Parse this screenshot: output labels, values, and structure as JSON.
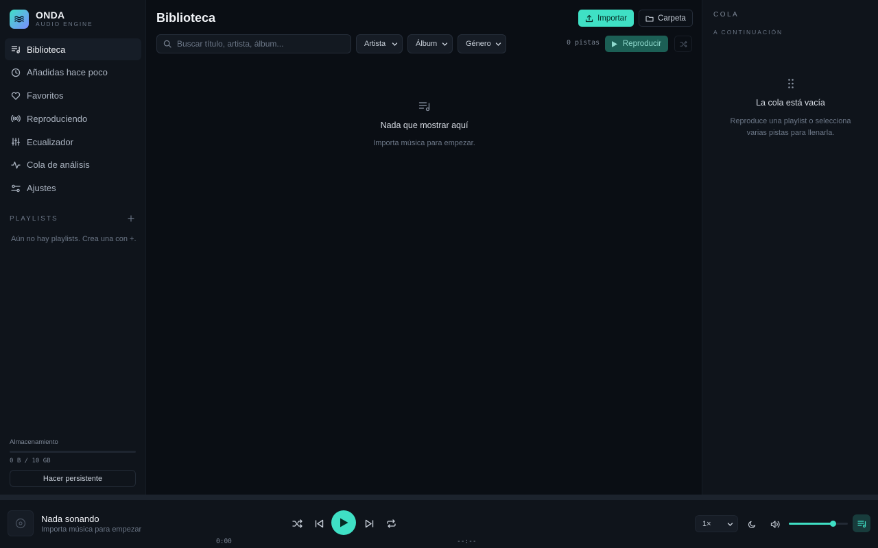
{
  "brand": {
    "name": "ONDA",
    "subtitle": "AUDIO ENGINE"
  },
  "sidebar": {
    "items": [
      {
        "label": "Biblioteca",
        "icon": "library-icon",
        "active": true
      },
      {
        "label": "Añadidas hace poco",
        "icon": "clock-icon"
      },
      {
        "label": "Favoritos",
        "icon": "heart-icon"
      },
      {
        "label": "Reproduciendo",
        "icon": "broadcast-icon"
      },
      {
        "label": "Ecualizador",
        "icon": "equalizer-icon"
      },
      {
        "label": "Cola de análisis",
        "icon": "activity-icon"
      },
      {
        "label": "Ajustes",
        "icon": "settings-sliders-icon"
      }
    ],
    "playlists_title": "PLAYLISTS",
    "playlists_empty": "Aún no hay playlists. Crea una con +.",
    "storage": {
      "label": "Almacenamiento",
      "value": "0 B / 10 GB",
      "fraction": 0,
      "persist_label": "Hacer persistente"
    }
  },
  "main": {
    "title": "Biblioteca",
    "import_label": "Importar",
    "folder_label": "Carpeta",
    "search_placeholder": "Buscar título, artista, álbum...",
    "filters": [
      "Artista",
      "Álbum",
      "Género"
    ],
    "count_text": "0 pistas",
    "play_label": "Reproducir",
    "empty_title": "Nada que mostrar aquí",
    "empty_sub": "Importa música para empezar."
  },
  "queue": {
    "title": "COLA",
    "subtitle": "A CONTINUACIÓN",
    "empty_title": "La cola está vacía",
    "empty_sub": "Reproduce una playlist o selecciona varias pistas para llenarla."
  },
  "player": {
    "title": "Nada sonando",
    "subtitle": "Importa música para empezar",
    "time_current": "0:00",
    "time_total": "--:--",
    "speed": "1×",
    "volume": 0.75
  },
  "colors": {
    "accent": "#3fe0c5",
    "background": "#0a0e14",
    "panel": "#0f141b"
  }
}
